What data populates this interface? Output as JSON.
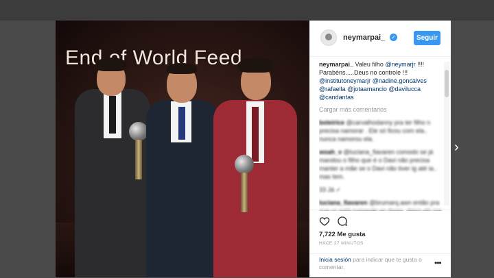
{
  "photo": {
    "sign_text": "End of World Feed"
  },
  "post": {
    "username": "neymarpai_",
    "follow_label": "Seguir",
    "verified_glyph": "✓",
    "caption_user": "neymarpai_",
    "caption_parts": [
      "Valeu filho",
      "@neymarjr",
      "!!!!",
      "Parabéns.....Deus no controle !!!"
    ],
    "caption_mentions": [
      "@institutoneymarjr",
      "@nadine.goncalves",
      "@rafaella",
      "@jotaamancio",
      "@davilucca",
      "@candantas"
    ],
    "load_more": "Cargar más comentarios",
    "comments": [
      {
        "user": "boleirice",
        "text": "@carvalhodanny pra ter filho n precisa namorar . Ele só ficou com ela.. nunca namorou ela."
      },
      {
        "user": "woah_v",
        "text": "@luciana_fiavaren comodo se já mandou o filho que é o Davi não precisa manter a mãe se o Davi não tiver ig até ia.. mas tem."
      },
      {
        "user": "",
        "text": "33 Já ✓"
      },
      {
        "user": "luciana_fiavaren",
        "text": "@brumarq.awn então pra que vc está sumando as dores, deixa ele me responder."
      }
    ],
    "likes": "7,722 Me gusta",
    "timestamp": "HACE 27 MINUTOS",
    "login_link": "Inicia sesión",
    "login_rest": "para indicar que te gusta o comentar.",
    "more_glyph": "•••"
  },
  "nav": {
    "next_glyph": "›"
  },
  "colors": {
    "accent": "#3897f0",
    "suit_right": "#9e2a36",
    "suit_left": "#2c2c2e",
    "suit_center": "#1f2633"
  },
  "icons": [
    "heart-icon",
    "comment-icon",
    "verified-icon",
    "chevron-right-icon",
    "more-icon"
  ]
}
